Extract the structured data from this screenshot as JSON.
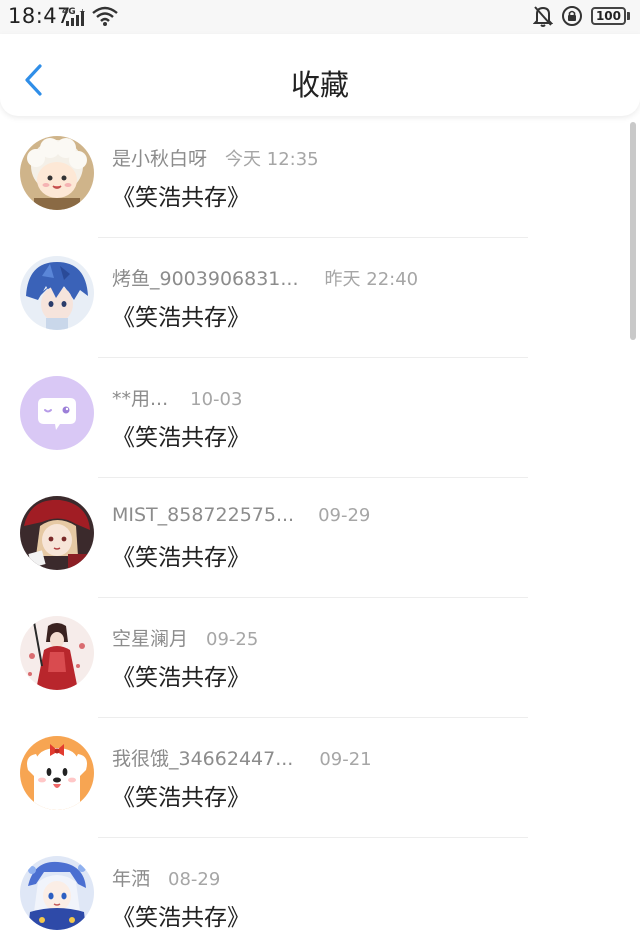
{
  "status_bar": {
    "time": "18:47",
    "network": "4G",
    "battery": "100"
  },
  "header": {
    "title": "收藏",
    "back_icon": "chevron-left-icon",
    "accent_color": "#2f8ee8"
  },
  "favorites": [
    {
      "name": "是小秋白呀",
      "time": "今天 12:35",
      "content": "《笑浩共存》",
      "avatar": "sheep-avatar"
    },
    {
      "name": "烤鱼_9003906831...",
      "time": "昨天 22:40",
      "content": "《笑浩共存》",
      "avatar": "blue-hair-avatar"
    },
    {
      "name": "**用...",
      "time": "10-03",
      "content": "《笑浩共存》",
      "avatar": "purple-chat-avatar"
    },
    {
      "name": "MIST_858722575...",
      "time": "09-29",
      "content": "《笑浩共存》",
      "avatar": "red-hat-avatar"
    },
    {
      "name": "空星澜月",
      "time": "09-25",
      "content": "《笑浩共存》",
      "avatar": "red-dress-avatar"
    },
    {
      "name": "我很饿_34662447...",
      "time": "09-21",
      "content": "《笑浩共存》",
      "avatar": "white-puppy-avatar"
    },
    {
      "name": "年洒",
      "time": "08-29",
      "content": "《笑浩共存》",
      "avatar": "blue-costume-avatar"
    }
  ]
}
